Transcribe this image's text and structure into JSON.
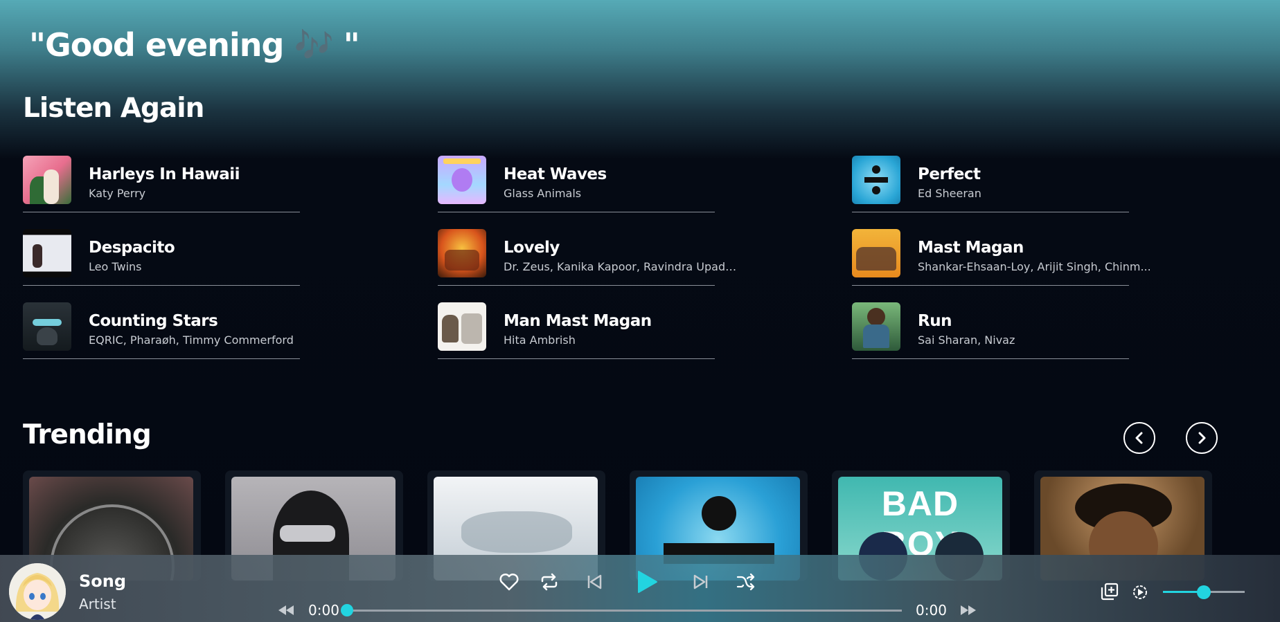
{
  "greeting": "\"Good evening 🎶 \"",
  "listen_again": {
    "title": "Listen Again",
    "songs": [
      {
        "title": "Harleys In Hawaii",
        "artist": "Katy Perry"
      },
      {
        "title": "Heat Waves",
        "artist": "Glass Animals"
      },
      {
        "title": "Perfect",
        "artist": "Ed Sheeran"
      },
      {
        "title": "Despacito",
        "artist": "Leo Twins"
      },
      {
        "title": "Lovely",
        "artist": "Dr. Zeus, Kanika Kapoor, Ravindra Upadh..."
      },
      {
        "title": "Mast Magan",
        "artist": "Shankar-Ehsaan-Loy, Arijit Singh, Chinm..."
      },
      {
        "title": "Counting Stars",
        "artist": "EQRIC, Pharaøh, Timmy Commerford"
      },
      {
        "title": "Man Mast Magan",
        "artist": "Hita Ambrish"
      },
      {
        "title": "Run",
        "artist": "Sai Sharan, Nivaz"
      }
    ]
  },
  "trending": {
    "title": "Trending",
    "card_texts": [
      "BAD BOY"
    ]
  },
  "player": {
    "song": "Song",
    "artist": "Artist",
    "current_time": "0:00",
    "duration": "0:00",
    "progress": 0,
    "volume": 0.5
  },
  "colors": {
    "accent": "#22d4e0",
    "background": "#040812",
    "header_gradient_top": "#56aab6"
  },
  "icons": [
    "heart-icon",
    "repeat-icon",
    "previous-icon",
    "play-icon",
    "next-icon",
    "shuffle-icon",
    "rewind-icon",
    "fast-forward-icon",
    "add-to-playlist-icon",
    "speed-icon",
    "chevron-left-icon",
    "chevron-right-icon"
  ]
}
